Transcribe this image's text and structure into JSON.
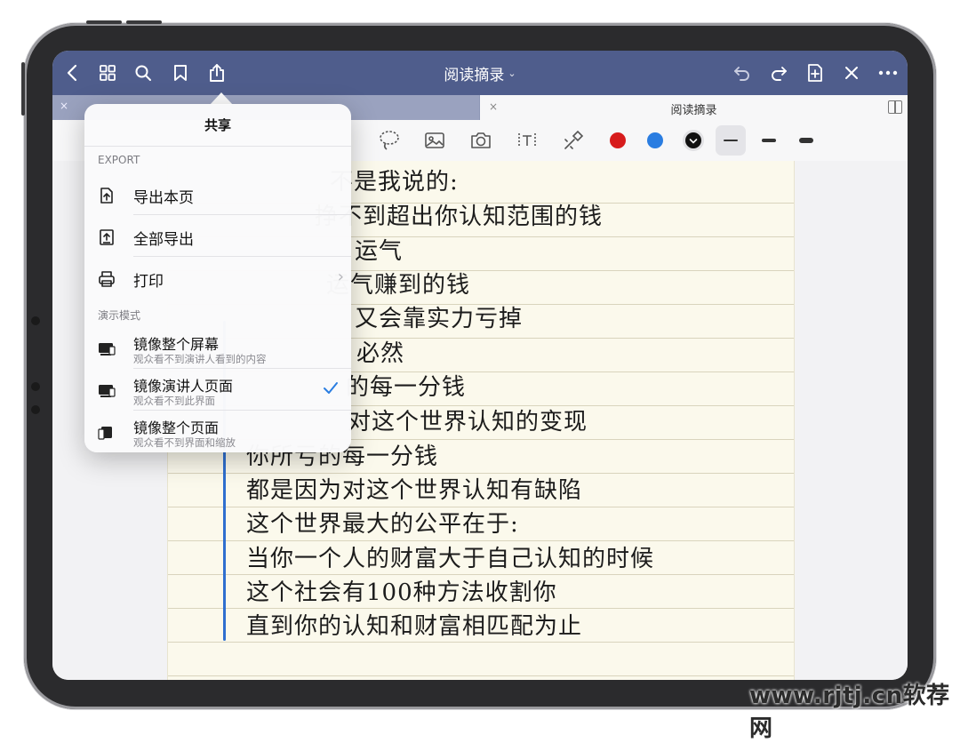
{
  "app": {
    "title": "阅读摘录",
    "title_chevron": "⌄"
  },
  "tabs": [
    {
      "label": ""
    },
    {
      "label": "阅读摘录"
    }
  ],
  "tab_close_glyph": "×",
  "toolbar_icons": [
    "back-icon",
    "grid-icon",
    "search-icon",
    "bookmark-icon",
    "share-icon",
    "undo-icon",
    "redo-icon",
    "add-page-icon",
    "close-icon",
    "more-icon"
  ],
  "colors": {
    "topbar": "#4f5d8c",
    "pen_red": "#d71c1c",
    "pen_blue": "#2a7de1",
    "pen_black": "#111111",
    "quote_bar": "#2f6fcf",
    "check": "#2a7de1"
  },
  "share_popover": {
    "title": "共享",
    "export_header": "EXPORT",
    "export_items": [
      {
        "label": "导出本页",
        "icon": "export-page-icon"
      },
      {
        "label": "全部导出",
        "icon": "export-all-icon"
      },
      {
        "label": "打印",
        "icon": "print-icon",
        "chevron": "›"
      }
    ],
    "present_header": "演示模式",
    "present_items": [
      {
        "label": "镜像整个屏幕",
        "sub": "观众看不到演讲人看到的内容",
        "icon": "mirror-screen-icon",
        "selected": false
      },
      {
        "label": "镜像演讲人页面",
        "sub": "观众看不到此界面",
        "icon": "mirror-presenter-icon",
        "selected": true
      },
      {
        "label": "镜像整个页面",
        "sub": "观众看不到界面和缩放",
        "icon": "mirror-page-icon",
        "selected": false
      }
    ]
  },
  "note_lines": [
    "不是我说的:",
    "挣不到超出你认知范围的钱",
    "运气",
    "运气赚到的钱",
    "又会靠实力亏掉",
    "必然",
    "的每一分钱",
    "对这个世界认知的变现",
    "你所亏的每一分钱",
    "都是因为对这个世界认知有缺陷",
    "这个世界最大的公平在于:",
    "当你一个人的财富大于自己认知的时候",
    "这个社会有100种方法收割你",
    "直到你的认知和财富相匹配为止"
  ],
  "watermark": "www.rjtj.cn软荐网"
}
